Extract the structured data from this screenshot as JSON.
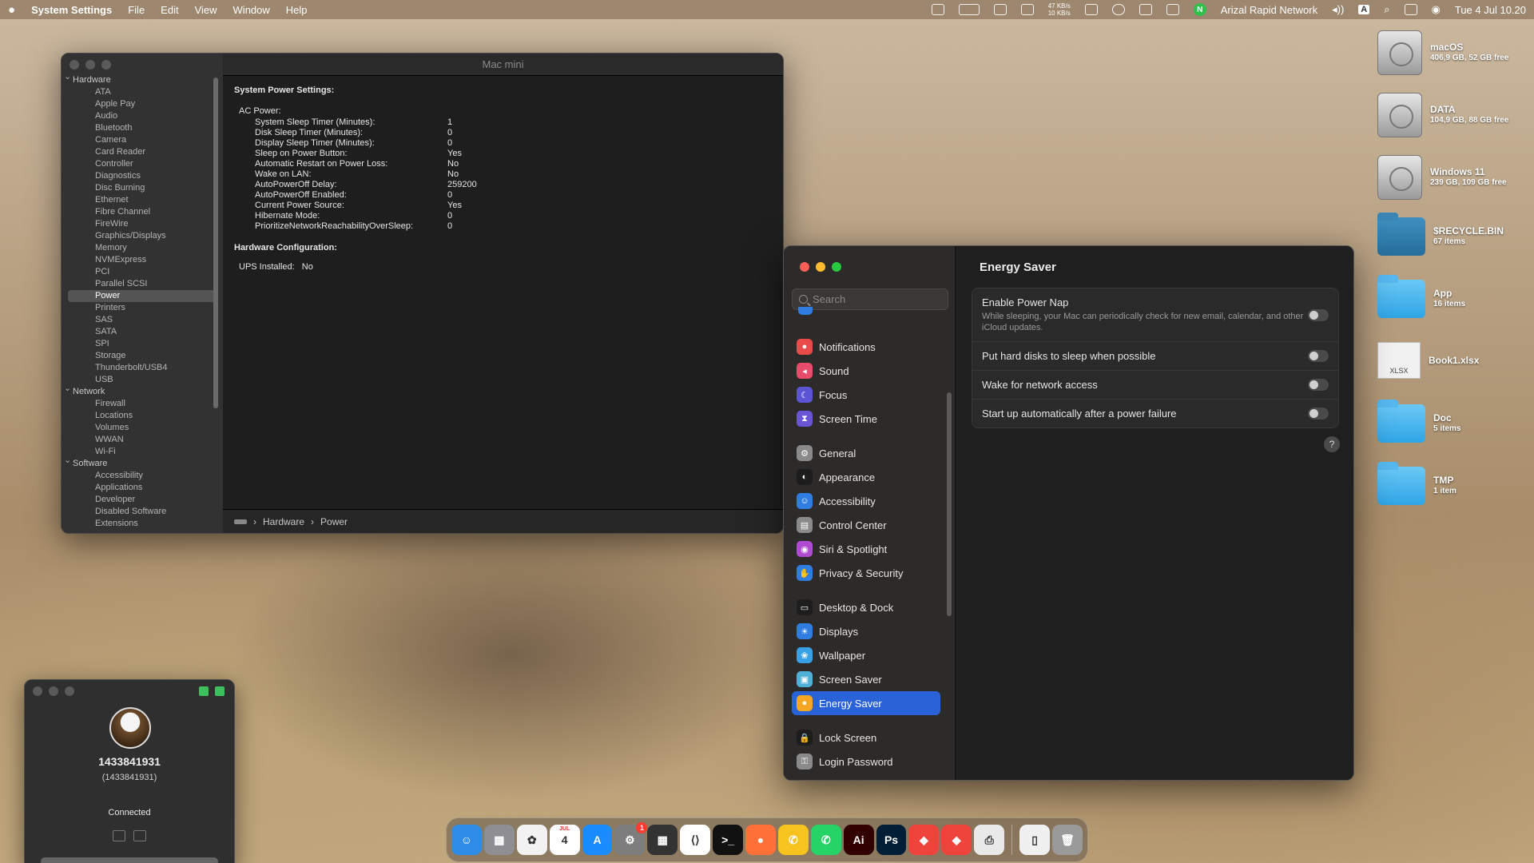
{
  "menubar": {
    "app_name": "System Settings",
    "menus": [
      "File",
      "Edit",
      "View",
      "Window",
      "Help"
    ],
    "net_up": "47 KB/s",
    "net_down": "10 KB/s",
    "network_name": "Arizal Rapid Network",
    "keyboard_input": "A",
    "datetime": "Tue 4 Jul  10.20"
  },
  "sysinfo": {
    "title": "Mac mini",
    "tree": [
      {
        "group": "Hardware",
        "items": [
          "ATA",
          "Apple Pay",
          "Audio",
          "Bluetooth",
          "Camera",
          "Card Reader",
          "Controller",
          "Diagnostics",
          "Disc Burning",
          "Ethernet",
          "Fibre Channel",
          "FireWire",
          "Graphics/Displays",
          "Memory",
          "NVMExpress",
          "PCI",
          "Parallel SCSI",
          "Power",
          "Printers",
          "SAS",
          "SATA",
          "SPI",
          "Storage",
          "Thunderbolt/USB4",
          "USB"
        ]
      },
      {
        "group": "Network",
        "items": [
          "Firewall",
          "Locations",
          "Volumes",
          "WWAN",
          "Wi-Fi"
        ]
      },
      {
        "group": "Software",
        "items": [
          "Accessibility",
          "Applications",
          "Developer",
          "Disabled Software",
          "Extensions"
        ]
      }
    ],
    "selected_item": "Power",
    "heading_power": "System Power Settings:",
    "ac_power_label": "AC Power:",
    "power_settings": [
      {
        "k": "System Sleep Timer (Minutes):",
        "v": "1"
      },
      {
        "k": "Disk Sleep Timer (Minutes):",
        "v": "0"
      },
      {
        "k": "Display Sleep Timer (Minutes):",
        "v": "0"
      },
      {
        "k": "Sleep on Power Button:",
        "v": "Yes"
      },
      {
        "k": "Automatic Restart on Power Loss:",
        "v": "No"
      },
      {
        "k": "Wake on LAN:",
        "v": "No"
      },
      {
        "k": "AutoPowerOff Delay:",
        "v": "259200"
      },
      {
        "k": "AutoPowerOff Enabled:",
        "v": "0"
      },
      {
        "k": "Current Power Source:",
        "v": "Yes"
      },
      {
        "k": "Hibernate Mode:",
        "v": "0"
      },
      {
        "k": "PrioritizeNetworkReachabilityOverSleep:",
        "v": "0"
      }
    ],
    "heading_hw": "Hardware Configuration:",
    "ups_label": "UPS Installed:",
    "ups_value": "No",
    "breadcrumb": [
      "Hardware",
      "Power"
    ]
  },
  "desktop": {
    "items": [
      {
        "name": "macOS",
        "detail": "406,9 GB, 52 GB free",
        "kind": "disk"
      },
      {
        "name": "DATA",
        "detail": "104,9 GB, 88 GB free",
        "kind": "disk"
      },
      {
        "name": "Windows 11",
        "detail": "239 GB, 109 GB free",
        "kind": "disk"
      },
      {
        "name": "$RECYCLE.BIN",
        "detail": "67 items",
        "kind": "folder-dark"
      },
      {
        "name": "App",
        "detail": "16 items",
        "kind": "folder"
      },
      {
        "name": "Book1.xlsx",
        "detail": "",
        "kind": "xlsx"
      },
      {
        "name": "Doc",
        "detail": "5 items",
        "kind": "folder"
      },
      {
        "name": "TMP",
        "detail": "1 item",
        "kind": "folder"
      }
    ],
    "xlsx_badge": "XLSX"
  },
  "settings": {
    "search_placeholder": "Search",
    "sidebar": [
      [
        {
          "label": "Notifications",
          "color": "#e94b4b",
          "icon": "bell-icon",
          "glyph": "●"
        },
        {
          "label": "Sound",
          "color": "#e94b6a",
          "icon": "speaker-icon",
          "glyph": "◂"
        },
        {
          "label": "Focus",
          "color": "#5b55d6",
          "icon": "moon-icon",
          "glyph": "☾"
        },
        {
          "label": "Screen Time",
          "color": "#6a55d6",
          "icon": "hourglass-icon",
          "glyph": "⧗"
        }
      ],
      [
        {
          "label": "General",
          "color": "#8a8a8a",
          "icon": "gear-icon",
          "glyph": "⚙"
        },
        {
          "label": "Appearance",
          "color": "#1d1d1d",
          "icon": "appearance-icon",
          "glyph": "◐"
        },
        {
          "label": "Accessibility",
          "color": "#2f7de1",
          "icon": "accessibility-icon",
          "glyph": "☺"
        },
        {
          "label": "Control Center",
          "color": "#8a8a8a",
          "icon": "control-center-icon",
          "glyph": "▤"
        },
        {
          "label": "Siri & Spotlight",
          "color": "#b04ad0",
          "icon": "siri-icon",
          "glyph": "◉"
        },
        {
          "label": "Privacy & Security",
          "color": "#2f7de1",
          "icon": "hand-icon",
          "glyph": "✋"
        }
      ],
      [
        {
          "label": "Desktop & Dock",
          "color": "#1d1d1d",
          "icon": "dock-icon",
          "glyph": "▭"
        },
        {
          "label": "Displays",
          "color": "#2f7de1",
          "icon": "sun-icon",
          "glyph": "☀"
        },
        {
          "label": "Wallpaper",
          "color": "#3aa0e6",
          "icon": "wallpaper-icon",
          "glyph": "❀"
        },
        {
          "label": "Screen Saver",
          "color": "#4fb0d8",
          "icon": "screen-saver-icon",
          "glyph": "▣"
        },
        {
          "label": "Energy Saver",
          "color": "#f5a623",
          "icon": "bulb-icon",
          "glyph": "●"
        }
      ],
      [
        {
          "label": "Lock Screen",
          "color": "#1d1d1d",
          "icon": "lock-icon",
          "glyph": "🔒"
        },
        {
          "label": "Login Password",
          "color": "#8a8a8a",
          "icon": "key-icon",
          "glyph": "⚿"
        }
      ]
    ],
    "selected": "Energy Saver",
    "pane_title": "Energy Saver",
    "options": [
      {
        "label": "Enable Power Nap",
        "desc": "While sleeping, your Mac can periodically check for new email, calendar, and other iCloud updates.",
        "on": false
      },
      {
        "label": "Put hard disks to sleep when possible",
        "desc": "",
        "on": false
      },
      {
        "label": "Wake for network access",
        "desc": "",
        "on": false
      },
      {
        "label": "Start up automatically after a power failure",
        "desc": "",
        "on": false
      }
    ],
    "help_label": "?"
  },
  "remote": {
    "name": "1433841931",
    "id": "(1433841931)",
    "status": "Connected"
  },
  "dock": {
    "apps": [
      {
        "name": "finder",
        "color": "#2e8be6",
        "glyph": "☺"
      },
      {
        "name": "launchpad",
        "color": "#8e8e93",
        "glyph": "▦"
      },
      {
        "name": "photos",
        "color": "#f2f2f2",
        "glyph": "✿"
      },
      {
        "name": "calendar",
        "color": "#ffffff",
        "glyph": "4"
      },
      {
        "name": "app-store",
        "color": "#1a8cff",
        "glyph": "A"
      },
      {
        "name": "system-settings",
        "color": "#7d7d7d",
        "glyph": "⚙",
        "badge": "1"
      },
      {
        "name": "calculator",
        "color": "#333333",
        "glyph": "▦"
      },
      {
        "name": "vscode",
        "color": "#ffffff",
        "glyph": "⟨⟩"
      },
      {
        "name": "terminal",
        "color": "#111111",
        "glyph": ">_"
      },
      {
        "name": "firefox",
        "color": "#ff7139",
        "glyph": "●"
      },
      {
        "name": "messages-yellow",
        "color": "#f7c31f",
        "glyph": "✆"
      },
      {
        "name": "whatsapp",
        "color": "#25d366",
        "glyph": "✆"
      },
      {
        "name": "illustrator",
        "color": "#330000",
        "glyph": "Ai"
      },
      {
        "name": "photoshop",
        "color": "#001e36",
        "glyph": "Ps"
      },
      {
        "name": "anydesk",
        "color": "#ef443b",
        "glyph": "◆"
      },
      {
        "name": "anydesk-2",
        "color": "#ef443b",
        "glyph": "◆"
      },
      {
        "name": "printer",
        "color": "#e9e9e9",
        "glyph": "⎙"
      }
    ],
    "extras": [
      {
        "name": "document",
        "color": "#f0f0f0",
        "glyph": "▯"
      },
      {
        "name": "trash",
        "color": "#9a9a9a",
        "glyph": "🗑"
      }
    ],
    "calendar_month": "JUL"
  }
}
